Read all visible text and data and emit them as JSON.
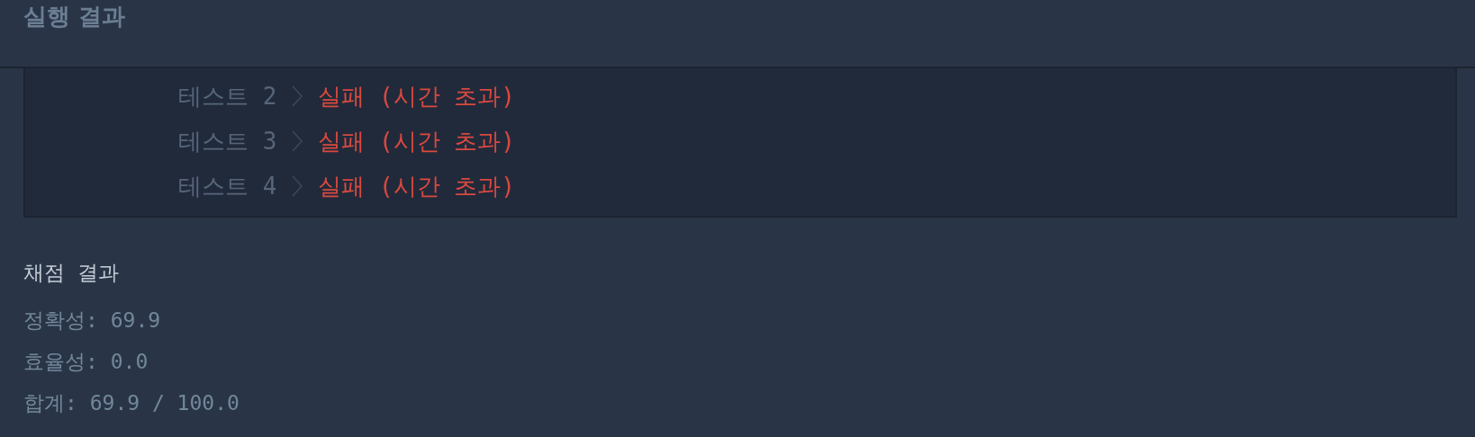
{
  "section_title": "실행 결과",
  "test_results": [
    {
      "label": "테스트 2",
      "result": "실패 (시간 초과)",
      "failed": true
    },
    {
      "label": "테스트 3",
      "result": "실패 (시간 초과)",
      "failed": true
    },
    {
      "label": "테스트 4",
      "result": "실패 (시간 초과)",
      "failed": true
    }
  ],
  "grading": {
    "title": "채점 결과",
    "lines": [
      "정확성: 69.9",
      "효율성: 0.0",
      "합계: 69.9 / 100.0"
    ]
  }
}
